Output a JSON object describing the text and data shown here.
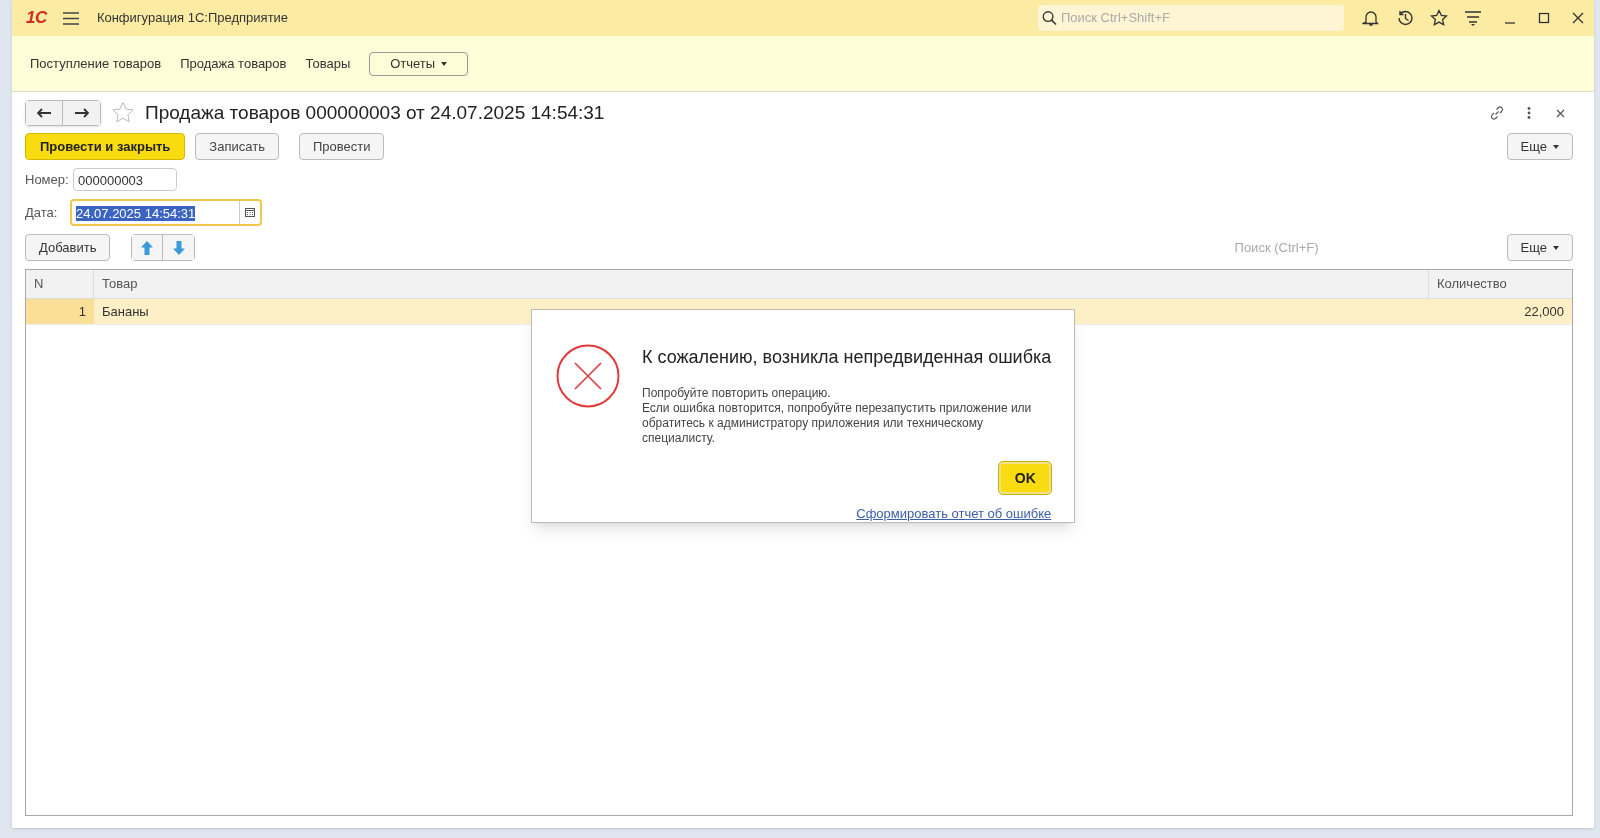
{
  "app_bar": {
    "logo": "1С",
    "title": "Конфигурация 1С:Предприятие",
    "search": {
      "placeholder": "Поиск Ctrl+Shift+F"
    }
  },
  "sections": [
    {
      "label": "Поступление товаров",
      "kind": "link"
    },
    {
      "label": "Продажа товаров",
      "kind": "link"
    },
    {
      "label": "Товары",
      "kind": "link"
    },
    {
      "label": "Отчеты",
      "kind": "menu"
    }
  ],
  "form": {
    "title": "Продажа товаров 000000003 от 24.07.2025 14:54:31",
    "favorite": false,
    "buttons": [
      {
        "label": "Провести и закрыть",
        "kind": "primary"
      },
      {
        "label": "Записать",
        "kind": "default"
      },
      {
        "label": "Провести",
        "kind": "default"
      }
    ],
    "more_label": "Еще",
    "fields": [
      {
        "label": "Номер:",
        "value": "000000003",
        "focused": false,
        "calendar": false
      },
      {
        "label": "Дата:",
        "value": "24.07.2025 14:54:31",
        "focused": true,
        "calendar": true
      }
    ],
    "table_toolbar": {
      "add_label": "Добавить",
      "search": {
        "placeholder": "Поиск (Ctrl+F)"
      },
      "more_label": "Еще"
    },
    "table": {
      "columns": [
        "N",
        "Товар",
        "Количество"
      ],
      "rows": [
        {
          "cells": [
            "1",
            "Бананы",
            "22,000"
          ],
          "selected": true
        }
      ]
    }
  },
  "dialog": {
    "title": "К сожалению, возникла непредвиденная ошибка",
    "message": [
      "Попробуйте повторить операцию.",
      "Если ошибка повторится, попробуйте перезапустить приложение или обратитесь к администратору приложения или техническому специалисту."
    ],
    "ok_label": "OK",
    "report_link": "Сформировать отчет об ошибке"
  }
}
